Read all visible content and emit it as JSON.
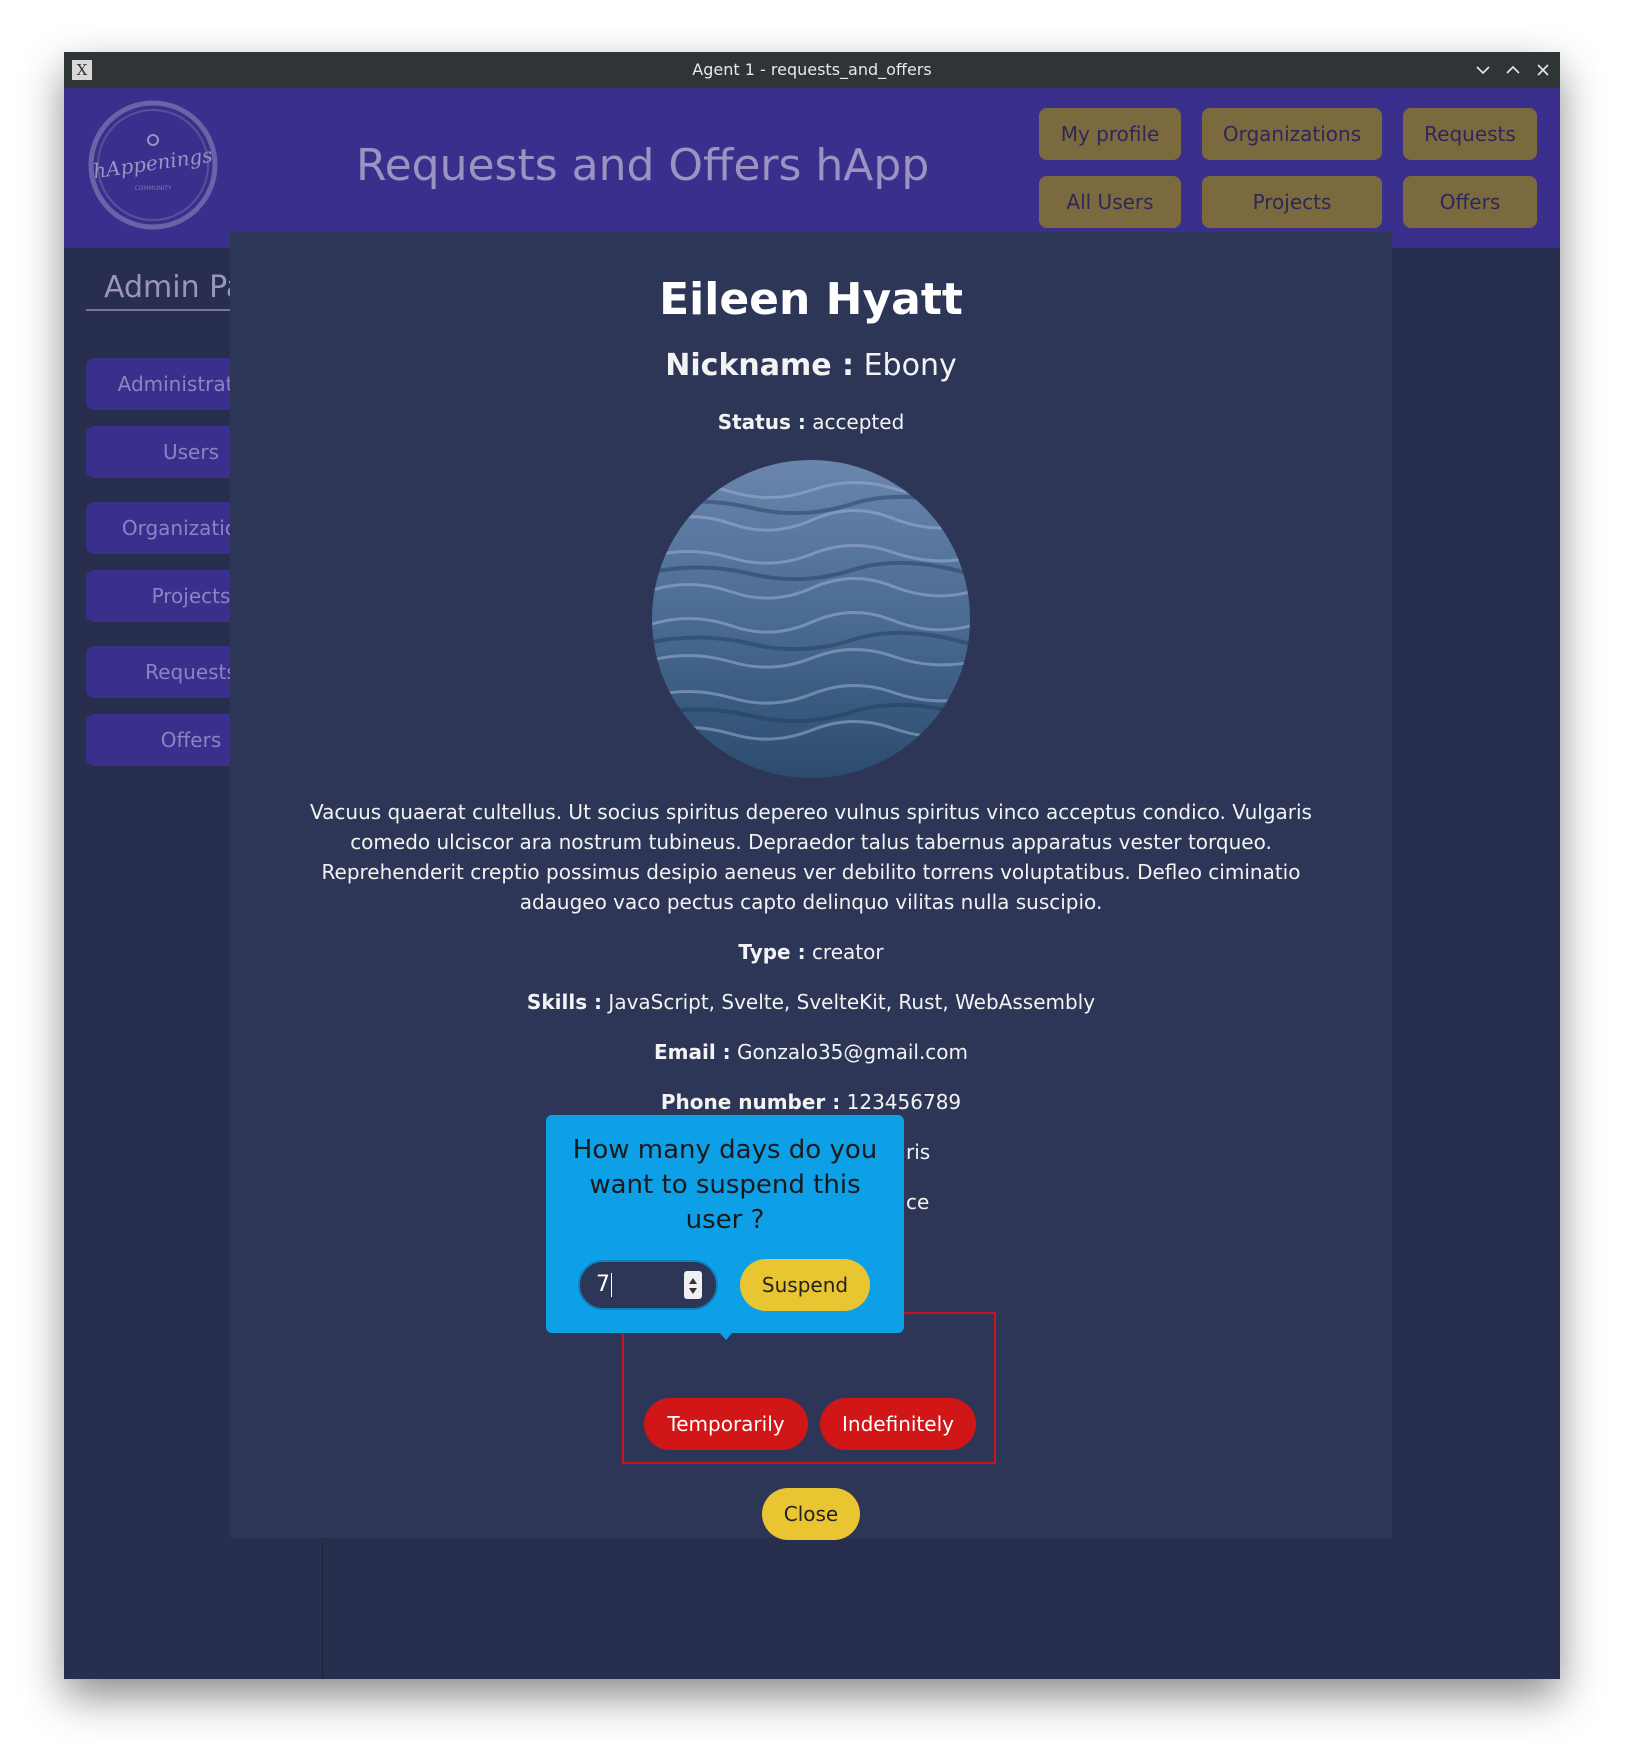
{
  "window": {
    "title": "Agent 1 - requests_and_offers"
  },
  "header": {
    "app_title": "Requests and Offers hApp",
    "logo_text": "hAppenings",
    "logo_subtext": "COMMUNITY",
    "nav": [
      "My profile",
      "Organizations",
      "Requests",
      "All Users",
      "Projects",
      "Offers"
    ]
  },
  "sidebar": {
    "title": "Admin Panel",
    "items": [
      "Administrators",
      "Users",
      "Organizations",
      "Projects",
      "Requests",
      "Offers"
    ]
  },
  "profile": {
    "name": "Eileen Hyatt",
    "nickname_label": "Nickname :",
    "nickname": "Ebony",
    "status_label": "Status :",
    "status": "accepted",
    "bio": "Vacuus quaerat cultellus. Ut socius spiritus depereo vulnus spiritus vinco acceptus condico. Vulgaris comedo ulciscor ara nostrum tubineus. Depraedor talus tabernus apparatus vester torqueo. Reprehenderit creptio possimus desipio aeneus ver debilito torrens voluptatibus. Defleo ciminatio adaugeo vaco pectus capto delinquo vilitas nulla suscipio.",
    "type_label": "Type :",
    "type": "creator",
    "skills_label": "Skills :",
    "skills": "JavaScript, Svelte, SvelteKit, Rust, WebAssembly",
    "email_label": "Email :",
    "email": "Gonzalo35@gmail.com",
    "phone_label": "Phone number :",
    "phone": "123456789",
    "partial_1": "ris",
    "partial_2": "ce"
  },
  "actions": {
    "temporarily": "Temporarily",
    "indefinitely": "Indefinitely",
    "close": "Close"
  },
  "popup": {
    "question": "How many days do you want to suspend this user ?",
    "days_value": "7",
    "suspend": "Suspend"
  },
  "colors": {
    "header_bg": "#3a2f8c",
    "modal_bg": "#2d3657",
    "popup_bg": "#0da0e7",
    "danger": "#d01616",
    "accent_yellow": "#e9c531"
  }
}
